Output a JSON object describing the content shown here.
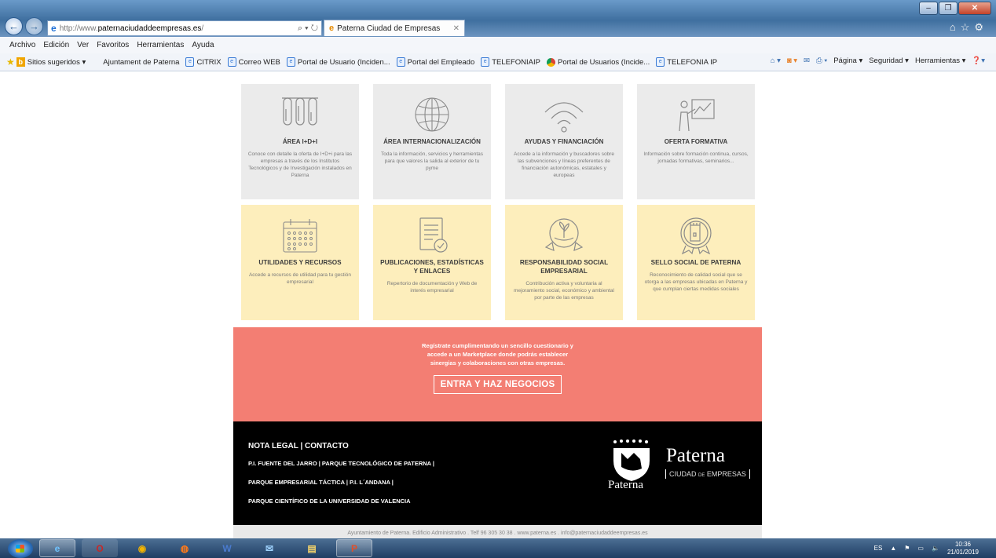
{
  "window": {
    "url_prefix": "http://www.",
    "url_domain": "paternaciudaddeempresas.es",
    "url_suffix": "/",
    "tab_title": "Paterna Ciudad de Empresas",
    "address_tools": "⌕ ▾ ↻"
  },
  "menu": [
    "Archivo",
    "Edición",
    "Ver",
    "Favoritos",
    "Herramientas",
    "Ayuda"
  ],
  "favorites": [
    {
      "label": "Sitios sugeridos ▾",
      "icon": "bing-icon"
    },
    {
      "label": "Ajuntament de Paterna",
      "icon": "none"
    },
    {
      "label": "CITRIX",
      "icon": "page-icon"
    },
    {
      "label": "Correo WEB",
      "icon": "page-icon"
    },
    {
      "label": "Portal de Usuario (Inciden...",
      "icon": "page-icon"
    },
    {
      "label": "Portal del Empleado",
      "icon": "page-icon"
    },
    {
      "label": "TELEFONIAIP",
      "icon": "page-icon"
    },
    {
      "label": "Portal de Usuarios (Incide...",
      "icon": "chrome-icon"
    },
    {
      "label": "TELEFONIA IP",
      "icon": "page-icon"
    }
  ],
  "command_bar": {
    "page": "Página ▾",
    "security": "Seguridad ▾",
    "tools": "Herramientas ▾"
  },
  "cards": [
    {
      "title": "ÁREA I+D+I",
      "desc": "Conoce con detalle la oferta de I+D+i para las empresas a través de los Institutos Tecnológicos y de Investigación instalados en Paterna",
      "icon": "test-tubes-icon",
      "color": "grey"
    },
    {
      "title": "ÁREA INTERNACIONALIZACIÓN",
      "desc": "Toda la información, servicios y herramientas para que valores la salida al exterior de tu pyme",
      "icon": "globe-icon",
      "color": "grey"
    },
    {
      "title": "AYUDAS Y FINANCIACIÓN",
      "desc": "Accede a la información y buscadores sobre las subvenciones y líneas preferentes de financiación autonómicas, estatales y europeas",
      "icon": "signal-icon",
      "color": "grey"
    },
    {
      "title": "OFERTA FORMATIVA",
      "desc": "Información sobre formación continua, cursos, jornadas formativas, seminarios...",
      "icon": "presentation-icon",
      "color": "grey"
    },
    {
      "title": "UTILIDADES Y RECURSOS",
      "desc": "Accede a recursos de utilidad para tu gestión empresarial",
      "icon": "calendar-icon",
      "color": "yellow"
    },
    {
      "title": "PUBLICACIONES, ESTADÍSTICAS Y ENLACES",
      "desc": "Repertorio de documentación y Web de interés empresarial",
      "icon": "document-check-icon",
      "color": "yellow"
    },
    {
      "title": "RESPONSABILIDAD SOCIAL EMPRESARIAL",
      "desc": "Contribución activa y voluntaria al mejoramiento social, económico y ambiental por parte de las empresas",
      "icon": "hand-plant-icon",
      "color": "yellow"
    },
    {
      "title": "SELLO SOCIAL DE PATERNA",
      "desc": "Reconocimiento de calidad social que se otorga a las empresas ubicadas en Paterna y que cumplan ciertas medidas sociales",
      "icon": "seal-tower-icon",
      "color": "yellow"
    }
  ],
  "cta": {
    "text": "Regístrate cumplimentando un sencillo cuestionario y accede a un Marketplace donde podrás establecer sinergias y colaboraciones con otras empresas.",
    "button": "ENTRA Y HAZ NEGOCIOS"
  },
  "footer": {
    "links": [
      "NOTA LEGAL | CONTACTO",
      "P.I. FUENTE DEL JARRO | PARQUE TECNOLÓGICO DE PATERNA |",
      "PARQUE EMPRESARIAL TÁCTICA | P.I. L´ANDANA |",
      "PARQUE CIENTÍFICO DE LA UNIVERSIDAD DE VALENCIA"
    ],
    "brand": "Paterna",
    "sub_main": "CIUDAD",
    "sub_de": "DE",
    "sub_end": "EMPRESAS",
    "shield_name": "Paterna",
    "bottom": "Ayuntamiento de Paterna. Edificio Administrativo . Telf 96 305 30 38 . www.paterna.es . info@paternaciudaddeempresas.es"
  },
  "tray": {
    "lang": "ES",
    "time": "10:36",
    "date": "21/01/2019"
  }
}
